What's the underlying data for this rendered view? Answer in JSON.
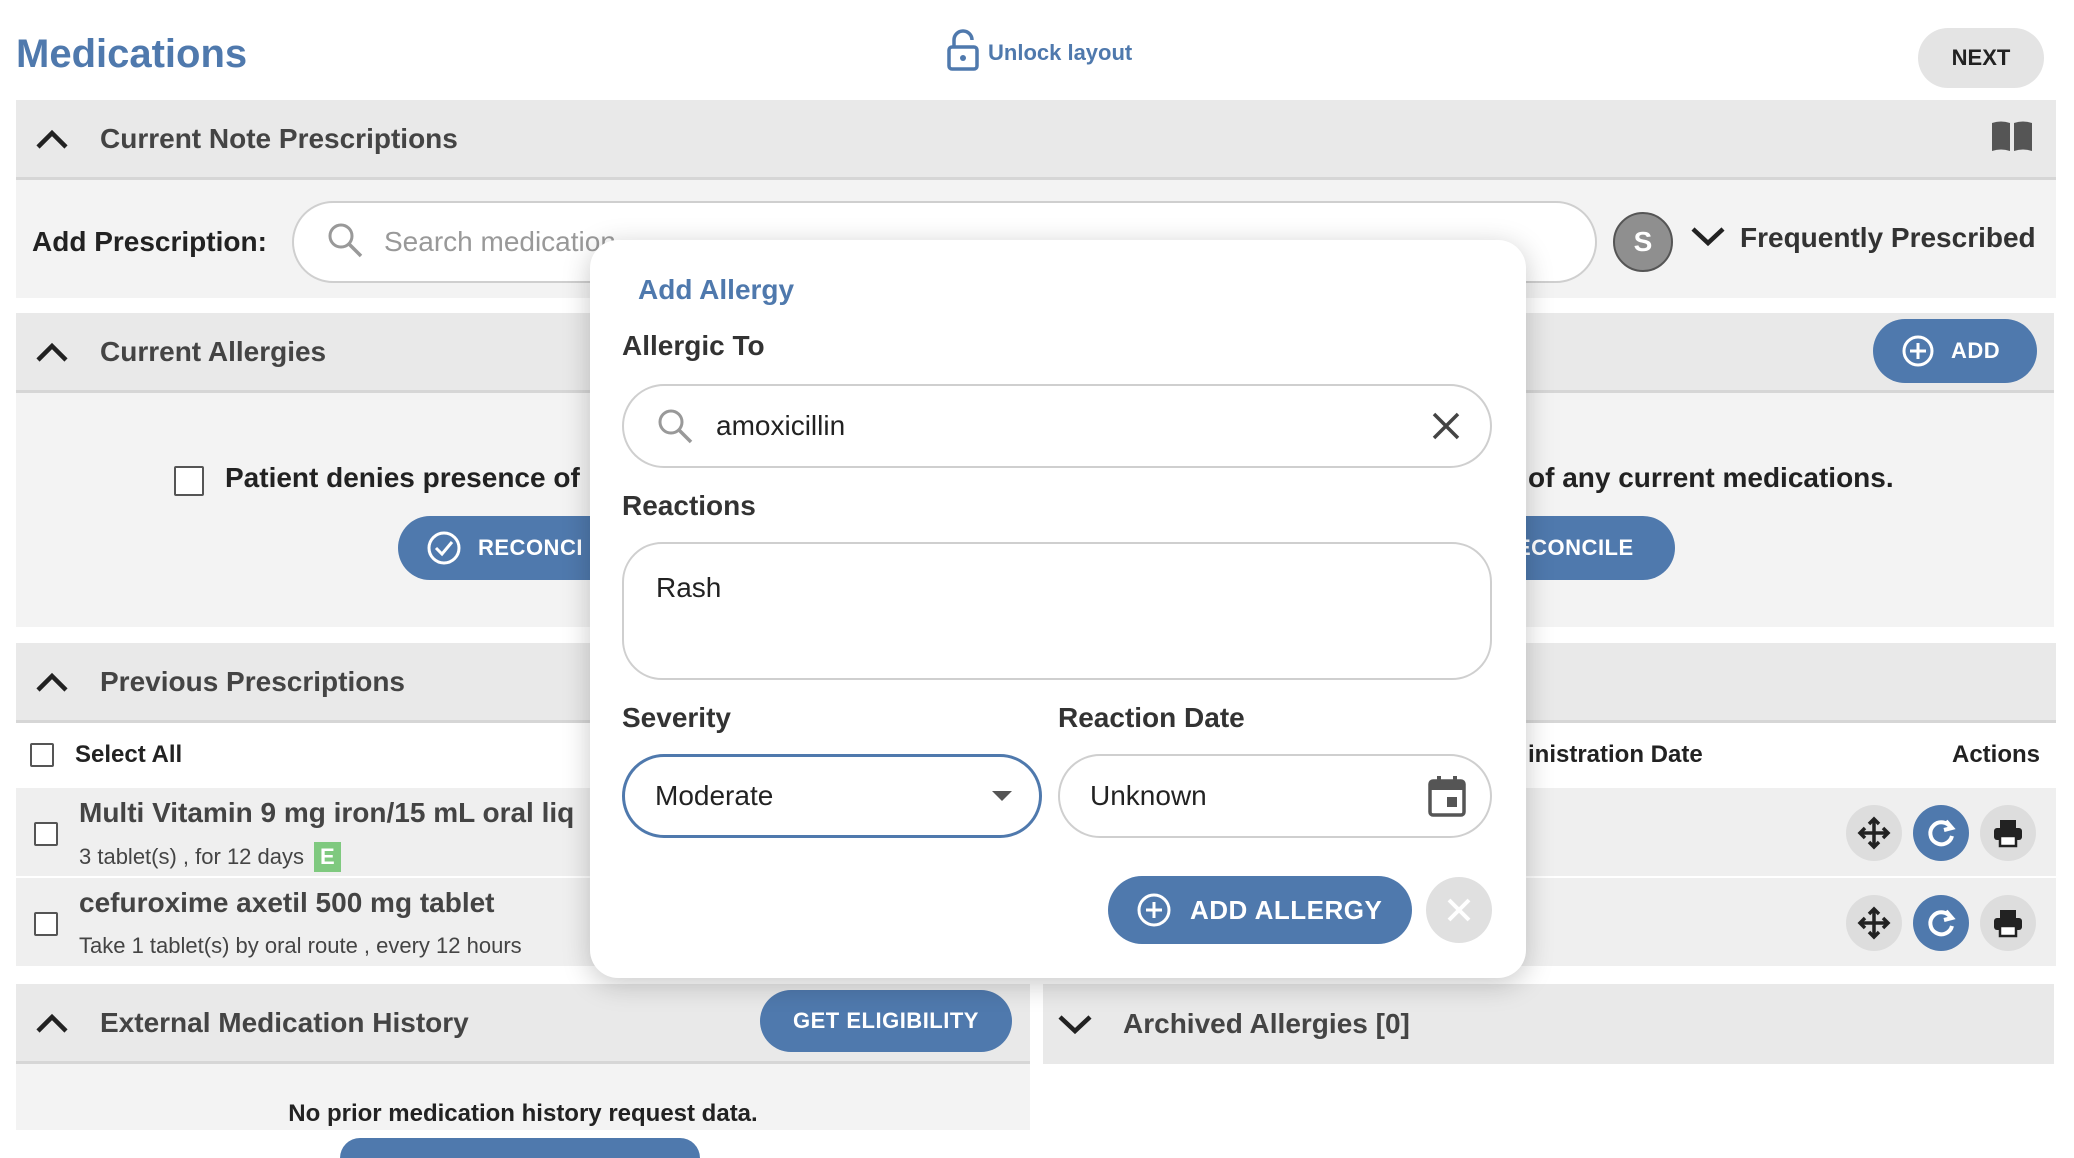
{
  "header": {
    "title": "Medications",
    "unlock_label": "Unlock layout",
    "next_label": "NEXT"
  },
  "current_note": {
    "title": "Current Note Prescriptions",
    "add_label": "Add Prescription:",
    "search_placeholder": "Search medication",
    "avatar_letter": "S",
    "frequently_label": "Frequently Prescribed"
  },
  "allergies": {
    "title": "Current Allergies",
    "add_label": "ADD",
    "denies_text": "Patient denies presence of",
    "reconcile_label": "RECONCI",
    "right_text": "of any current medications.",
    "right_reconcile_label": "ECONCILE"
  },
  "previous": {
    "title": "Previous Prescriptions",
    "select_all": "Select All",
    "col_admin_date": "inistration Date",
    "col_actions": "Actions",
    "rows": [
      {
        "name": "Multi Vitamin 9 mg iron/15 mL oral liq",
        "sub": "3 tablet(s) , for 12 days",
        "badge": "E"
      },
      {
        "name": "cefuroxime axetil 500 mg tablet",
        "sub": "Take 1 tablet(s) by oral route , every 12 hours"
      }
    ]
  },
  "external": {
    "title": "External Medication History",
    "eligibility_label": "GET ELIGIBILITY",
    "no_data": "No prior medication history request data."
  },
  "archived": {
    "title": "Archived Allergies [0]"
  },
  "modal": {
    "title": "Add Allergy",
    "allergic_to_label": "Allergic To",
    "allergic_to_value": "amoxicillin",
    "reactions_label": "Reactions",
    "reactions_value": "Rash",
    "severity_label": "Severity",
    "severity_value": "Moderate",
    "reaction_date_label": "Reaction Date",
    "reaction_date_value": "Unknown",
    "add_button_label": "ADD ALLERGY"
  },
  "colors": {
    "accent": "#4f79ad",
    "panel_header": "#e9e9e9",
    "panel_body": "#f3f3f3",
    "badge_green": "#7fc97f"
  }
}
